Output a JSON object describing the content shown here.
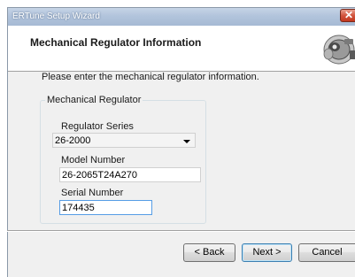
{
  "window": {
    "title": "ERTune Setup Wizard"
  },
  "header": {
    "heading": "Mechanical Regulator Information"
  },
  "instruction": "Please enter the mechanical regulator information.",
  "group": {
    "legend": "Mechanical Regulator",
    "regulator_series": {
      "label": "Regulator Series",
      "selected": "26-2000"
    },
    "model_number": {
      "label": "Model Number",
      "value": "26-2065T24A270"
    },
    "serial_number": {
      "label": "Serial Number",
      "value": "174435"
    }
  },
  "buttons": {
    "back": "< Back",
    "next": "Next >",
    "cancel": "Cancel"
  }
}
